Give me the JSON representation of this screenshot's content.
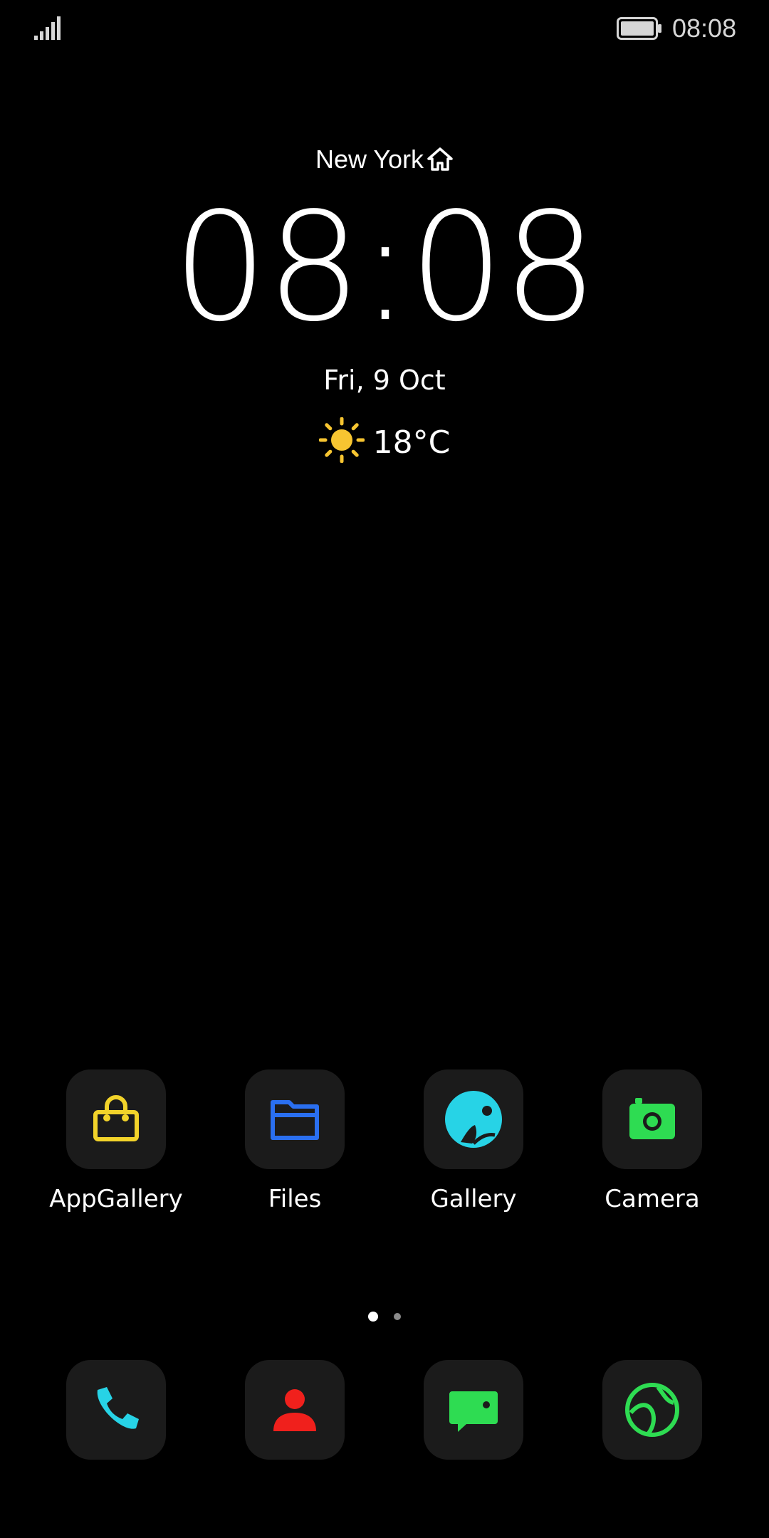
{
  "status_bar": {
    "time": "08:08",
    "signal_icon": "signal-bars-icon",
    "battery_icon": "battery-icon"
  },
  "clock_widget": {
    "city": "New York",
    "city_icon": "home-icon",
    "time": "08:08",
    "date": "Fri, 9 Oct",
    "weather_icon": "sun-icon",
    "temperature": "18°C"
  },
  "apps": [
    {
      "label": "AppGallery",
      "icon": "shopping-bag-icon",
      "color": "#f2d32a"
    },
    {
      "label": "Files",
      "icon": "folder-icon",
      "color": "#2a6ff0"
    },
    {
      "label": "Gallery",
      "icon": "gallery-icon",
      "color": "#27d3e6"
    },
    {
      "label": "Camera",
      "icon": "camera-icon",
      "color": "#2edc52"
    }
  ],
  "page_indicator": {
    "pages": 2,
    "current": 1
  },
  "dock": [
    {
      "name": "Phone",
      "icon": "phone-icon",
      "color": "#27d3e6"
    },
    {
      "name": "Contacts",
      "icon": "contact-icon",
      "color": "#f0201c"
    },
    {
      "name": "Messages",
      "icon": "message-icon",
      "color": "#2edc52"
    },
    {
      "name": "Browser",
      "icon": "browser-icon",
      "color": "#2edc52"
    }
  ],
  "colors": {
    "background": "#000000",
    "tile_background": "#1b1b1b",
    "text": "#ffffff",
    "sun": "#f7c531"
  }
}
